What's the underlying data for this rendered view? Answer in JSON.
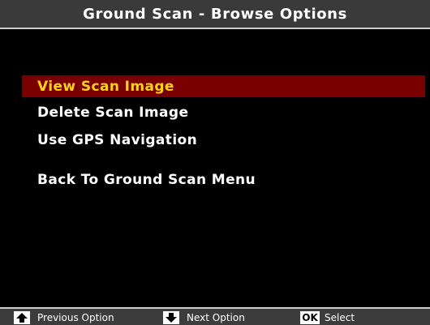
{
  "title": "Ground Scan - Browse Options",
  "menu": {
    "items": [
      {
        "label": "View Scan Image",
        "selected": true
      },
      {
        "label": "Delete Scan Image",
        "selected": false
      },
      {
        "label": "Use GPS Navigation",
        "selected": false
      },
      {
        "label": "Back To Ground Scan Menu",
        "selected": false
      }
    ]
  },
  "footer": {
    "hints": [
      {
        "icon": "arrow-up-icon",
        "label": "Previous Option"
      },
      {
        "icon": "arrow-down-icon",
        "label": "Next Option"
      },
      {
        "key_text": "OK",
        "label": "Select"
      }
    ]
  },
  "colors": {
    "background": "#000000",
    "title_bar": "#3a3a3a",
    "selected_background": "#7a0000",
    "selected_text": "#ffd21a",
    "text": "#ffffff"
  }
}
